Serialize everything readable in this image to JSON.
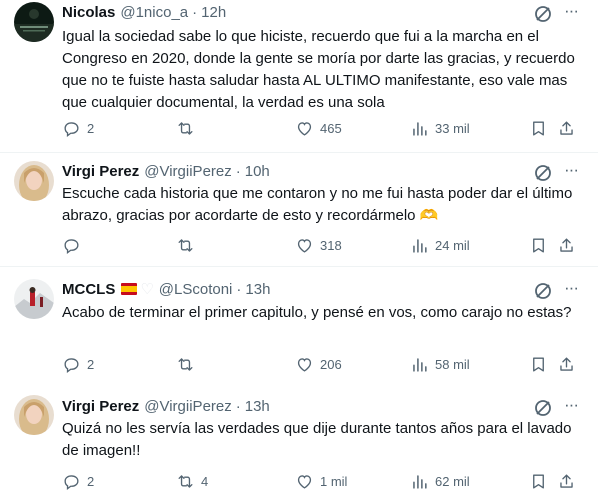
{
  "tweets": [
    {
      "name": "Nicolas",
      "handle": "@1nico_a",
      "dot": "·",
      "time": "12h",
      "flag": false,
      "text": "Igual la sociedad sabe lo que hiciste, recuerdo que fui a la marcha en el Congreso en 2020, donde la gente se moría por darte las gracias, y recuerdo que no te fuiste hasta saludar hasta AL ULTIMO manifestante, eso vale mas que cualquier documental, la verdad es una sola",
      "replies": "2",
      "retweets": "",
      "likes": "465",
      "views": "33 mil"
    },
    {
      "name": "Virgi Perez",
      "handle": "@VirgiiPerez",
      "dot": "·",
      "time": "10h",
      "flag": false,
      "text": "Escuche cada historia que me contaron y no me fui hasta poder dar el último abrazo, gracias por acordarte de esto y recordármelo 🫶",
      "replies": "",
      "retweets": "",
      "likes": "318",
      "views": "24 mil"
    },
    {
      "name": "MCCLS",
      "handle": "@LScotoni",
      "dot": "·",
      "time": "13h",
      "flag": true,
      "heart": "♡",
      "text": "Acabo de terminar el primer capitulo, y pensé en vos, como carajo no estas?",
      "replies": "2",
      "retweets": "",
      "likes": "206",
      "views": "58 mil"
    },
    {
      "name": "Virgi Perez",
      "handle": "@VirgiiPerez",
      "dot": "·",
      "time": "13h",
      "flag": false,
      "text": "Quizá no les servía las verdades que dije durante tantos años para el lavado de imagen!!",
      "replies": "2",
      "retweets": "4",
      "likes": "1 mil",
      "views": "62 mil"
    }
  ],
  "icons": {
    "reply": "reply-icon",
    "retweet": "retweet-icon",
    "like": "heart-icon",
    "views": "views-icon",
    "bookmark": "bookmark-icon",
    "share": "share-icon",
    "grok": "grok-icon",
    "more": "more-icon"
  },
  "more_glyph": "···",
  "colors": {
    "text": "#0f1419",
    "muted": "#536471",
    "divider": "#eff3f4",
    "thread": "#cfd9de"
  }
}
